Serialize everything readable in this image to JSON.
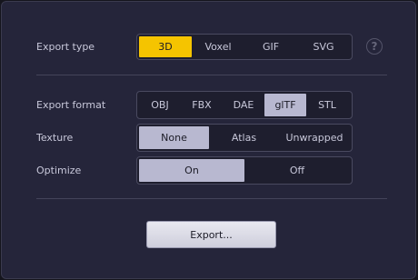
{
  "export_type": {
    "label": "Export type",
    "options": [
      "3D",
      "Voxel",
      "GIF",
      "SVG"
    ],
    "selected": "3D",
    "help_icon": "?"
  },
  "export_format": {
    "label": "Export format",
    "options": [
      "OBJ",
      "FBX",
      "DAE",
      "glTF",
      "STL"
    ],
    "selected": "glTF"
  },
  "texture": {
    "label": "Texture",
    "options": [
      "None",
      "Atlas",
      "Unwrapped"
    ],
    "selected": "None"
  },
  "optimize": {
    "label": "Optimize",
    "options": [
      "On",
      "Off"
    ],
    "selected": "On"
  },
  "export_button": "Export...",
  "colors": {
    "accent_yellow": "#f5c400",
    "selected_gray": "#b8b8d0",
    "panel_bg": "#25253a"
  }
}
